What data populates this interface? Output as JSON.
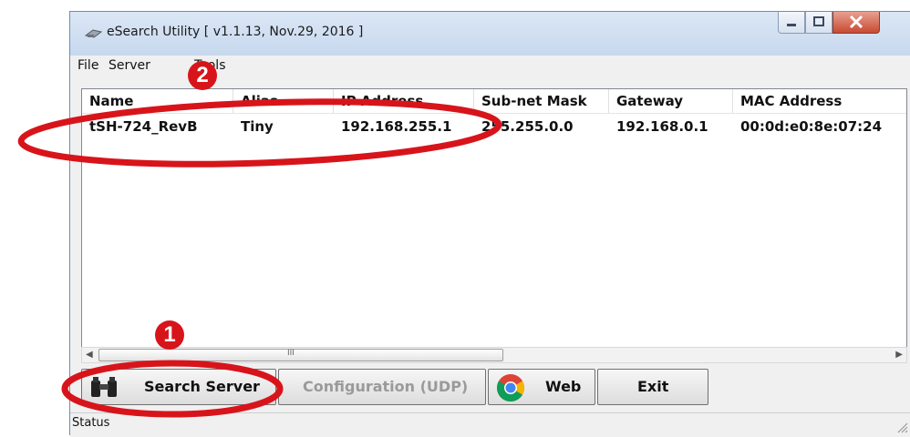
{
  "window": {
    "title": "eSearch Utility [ v1.1.13, Nov.29, 2016 ]"
  },
  "menu": {
    "items": [
      "File",
      "Server",
      "Tools"
    ]
  },
  "table": {
    "columns": [
      "Name",
      "Alias",
      "IP Address",
      "Sub-net Mask",
      "Gateway",
      "MAC Address"
    ],
    "rows": [
      [
        "tSH-724_RevB",
        "Tiny",
        "192.168.255.1",
        "255.255.0.0",
        "192.168.0.1",
        "00:0d:e0:8e:07:24"
      ]
    ]
  },
  "scrollbar": {
    "grip": "III"
  },
  "buttons": {
    "search": "Search Server",
    "config": "Configuration (UDP)",
    "web": "Web",
    "exit": "Exit"
  },
  "status": {
    "text": "Status"
  },
  "annotations": {
    "step1": "1",
    "step2": "2"
  },
  "colors": {
    "annotation": "#d8141b",
    "title_bar": "#c7d8ee",
    "close_button": "#c84a32"
  },
  "icons": [
    "app-icon",
    "minimize-icon",
    "maximize-icon",
    "close-icon",
    "binoculars-icon",
    "chrome-icon"
  ]
}
